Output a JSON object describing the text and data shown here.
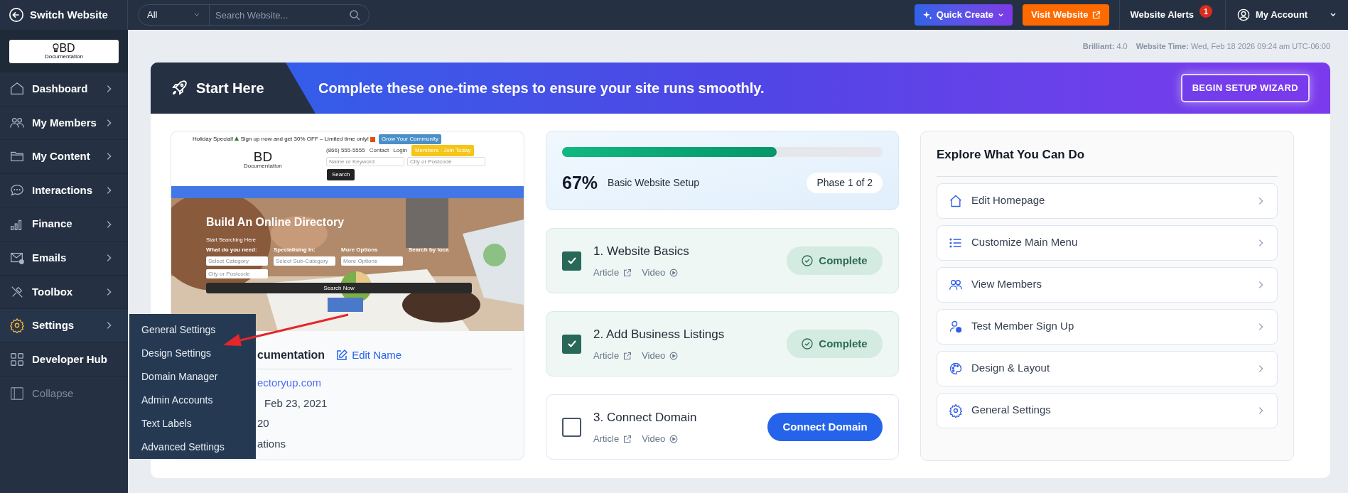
{
  "topbar": {
    "switch_label": "Switch Website",
    "search_scope": "All",
    "search_placeholder": "Search Website...",
    "quick_create": "Quick Create",
    "visit_website": "Visit Website",
    "alerts_label": "Website Alerts",
    "alerts_count": "1",
    "account_label": "My Account"
  },
  "sidebar": {
    "logo_mark": "BD",
    "logo_sub": "Documentation",
    "items": [
      {
        "label": "Dashboard",
        "kind": "nav",
        "selected": false,
        "expandable": true
      },
      {
        "label": "My Members",
        "kind": "nav",
        "selected": false,
        "expandable": true
      },
      {
        "label": "My Content",
        "kind": "nav",
        "selected": false,
        "expandable": true
      },
      {
        "label": "Interactions",
        "kind": "nav",
        "selected": false,
        "expandable": true
      },
      {
        "label": "Finance",
        "kind": "nav",
        "selected": false,
        "expandable": true
      },
      {
        "label": "Emails",
        "kind": "nav",
        "selected": false,
        "expandable": true
      },
      {
        "label": "Toolbox",
        "kind": "nav",
        "selected": false,
        "expandable": true
      },
      {
        "label": "Settings",
        "kind": "nav",
        "selected": true,
        "expandable": true
      },
      {
        "label": "Developer Hub",
        "kind": "nav",
        "selected": false,
        "expandable": false
      },
      {
        "label": "Collapse",
        "kind": "collapse",
        "selected": false,
        "expandable": false
      }
    ]
  },
  "settings_submenu": [
    "General Settings",
    "Design Settings",
    "Domain Manager",
    "Admin Accounts",
    "Text Labels",
    "Advanced Settings"
  ],
  "version_info": [
    {
      "label": "Brilliant:",
      "value": "4.0"
    },
    {
      "label": "Website Time:",
      "value": "Wed, Feb 18 2026 09:24 am UTC-06:00"
    }
  ],
  "banner": {
    "title": "Start Here",
    "message": "Complete these one-time steps to ensure your site runs smoothly.",
    "button": "BEGIN SETUP WIZARD"
  },
  "site_preview": {
    "promo_start": "Holiday Special!",
    "promo_end": "Sign up now and get 30% OFF – Limited time only!",
    "promo_button": "Grow Your Community",
    "phone": "(866) 555-5555",
    "contact": "Contact",
    "login": "Login",
    "join_button": "Members - Join Today",
    "logo_mark": "BD",
    "logo_sub": "Documentation",
    "keyword_placeholder": "Name or Keyword",
    "location_placeholder": "City or Postcode",
    "search_button": "Search",
    "hero_title": "Build An Online Directory",
    "hero_subtitle": "Start Searching Here",
    "hero_labels": [
      "What do you need:",
      "Specialising in:",
      "More Options",
      "Search by loca"
    ],
    "hero_fields": [
      "Select Category",
      "Select Sub-Category",
      "More Options"
    ],
    "hero_city": "City or Postcode",
    "hero_button": "Search Now"
  },
  "site_info": {
    "name": "cumentation",
    "edit_label": "Edit Name",
    "lines": [
      {
        "kind": "link",
        "text": "ectoryup.com"
      },
      {
        "kind": "text",
        "text": "Feb 23, 2021"
      },
      {
        "kind": "text",
        "text": "20"
      },
      {
        "kind": "text",
        "text": "ations"
      }
    ]
  },
  "progress": {
    "percent": "67%",
    "level": 0.67,
    "label": "Basic Website Setup",
    "phase": "Phase 1 of 2"
  },
  "steps": [
    {
      "title": "1. Website Basics",
      "checked": true,
      "article": "Article",
      "video": "Video",
      "action": "Complete"
    },
    {
      "title": "2. Add Business Listings",
      "checked": true,
      "article": "Article",
      "video": "Video",
      "action": "Complete"
    },
    {
      "title": "3. Connect Domain",
      "checked": false,
      "article": "Article",
      "video": "Video",
      "action": "Connect Domain"
    }
  ],
  "explore": {
    "title": "Explore What You Can Do",
    "items": [
      "Edit Homepage",
      "Customize Main Menu",
      "View Members",
      "Test Member Sign Up",
      "Design & Layout",
      "General Settings"
    ]
  }
}
